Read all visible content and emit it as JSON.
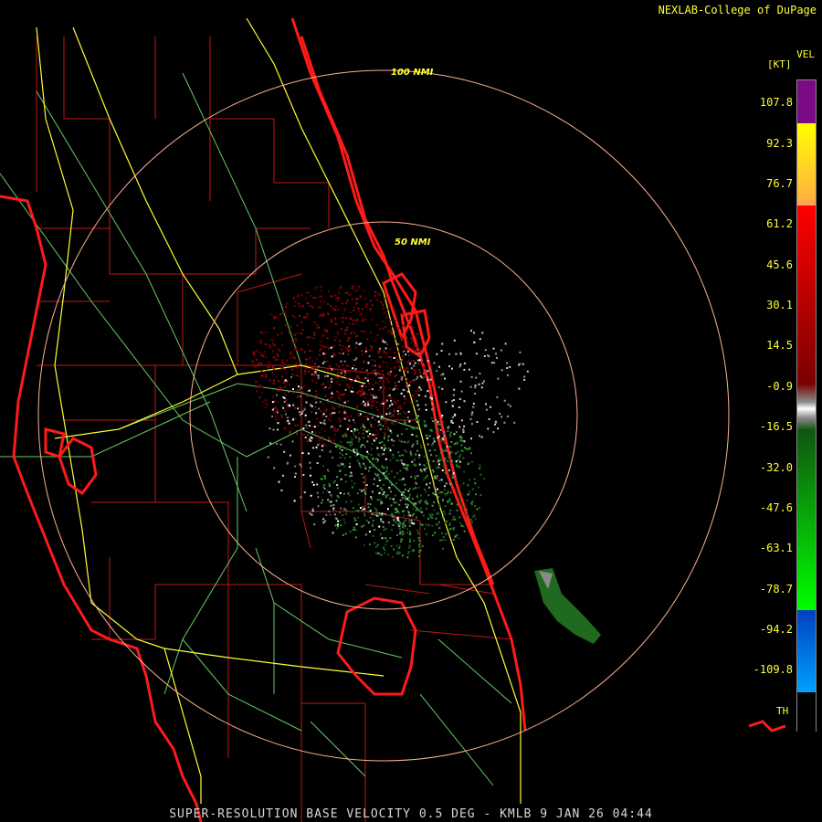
{
  "credit": "NEXLAB-College of DuPage",
  "footer": "SUPER-RESOLUTION BASE VELOCITY 0.5 DEG - KMLB 9 JAN 26 04:44",
  "legend": {
    "title": "VEL",
    "unit": "[KT]",
    "ticks": [
      "107.8",
      "92.3",
      "76.7",
      "61.2",
      "45.6",
      "30.1",
      "14.5",
      "-0.9",
      "-16.5",
      "-32.0",
      "-47.6",
      "-63.1",
      "-78.7",
      "-94.2",
      "-109.8"
    ],
    "threshold_label": "TH",
    "colors": {
      "purple": "#7a0a86",
      "yellow": "#ffff00",
      "orange": "#ffa060",
      "red": "#ff0000",
      "darkred": "#7a0000",
      "gray": "#8a8a8a",
      "green": "#00a000",
      "blue": "#0040c0",
      "cyan": "#00a0ff",
      "black": "#000000"
    }
  },
  "rings": {
    "inner_label": "50 NMI",
    "outer_label": "100 NMI"
  },
  "colors": {
    "coast": "#ff1a1a",
    "county": "#c01818",
    "highway_primary": "#ffff33",
    "highway_secondary": "#66cc66",
    "ring": "#ffb090"
  }
}
